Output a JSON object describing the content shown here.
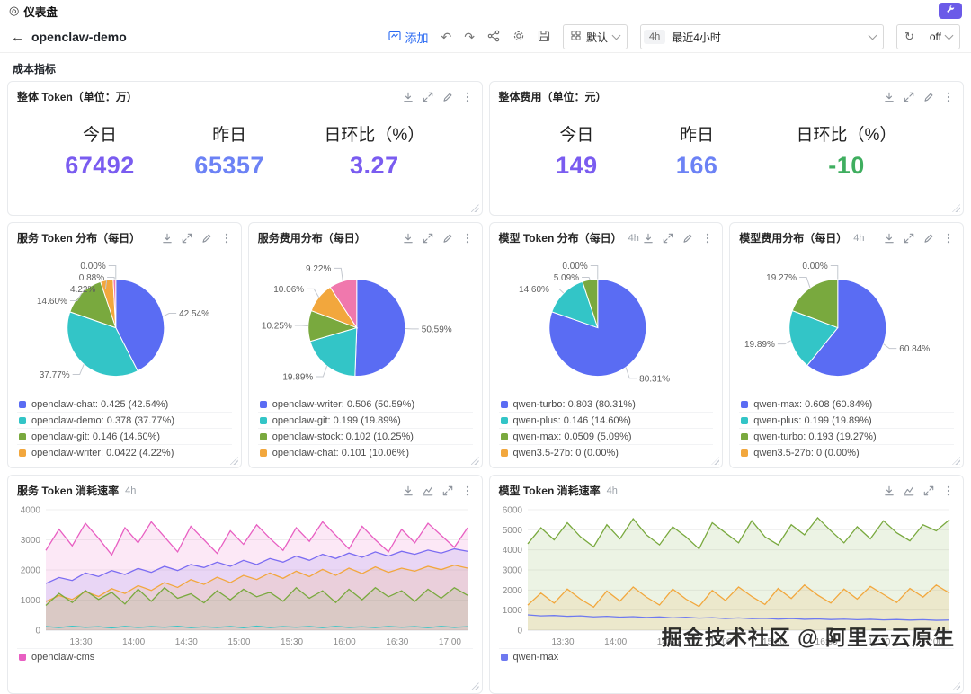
{
  "topbar": {
    "brand": "仪表盘",
    "brand_icon": "◎"
  },
  "navbar": {
    "back_icon": "←",
    "dashboard_name": "openclaw-demo",
    "add_label": "添加",
    "undo_icon": "↶",
    "redo_icon": "↷",
    "view_select": {
      "value": "默认"
    },
    "time_picker": {
      "chip": "4h",
      "value": "最近4小时"
    },
    "refresh": {
      "icon": "↻",
      "interval": "off"
    }
  },
  "section_title": "成本指标",
  "watermark": "掘金技术社区 @ 阿里云云原生",
  "colors": {
    "accent_button": "#6b5ae8",
    "add_link": "#2a6af2",
    "stat_purple": "#7a5cf0",
    "stat_blue": "#6c82f5",
    "stat_green": "#3fae5f",
    "pie_purple": "#5a6cf3",
    "pie_teal": "#33c5c7",
    "pie_green": "#79a93e",
    "pie_orange": "#f2a73d",
    "pie_pink": "#f078ad"
  },
  "stat_panels": [
    {
      "title": "整体 Token（单位：万）",
      "stats": [
        {
          "label": "今日",
          "value": "67492",
          "color": "#7a5cf0"
        },
        {
          "label": "昨日",
          "value": "65357",
          "color": "#6c82f5"
        },
        {
          "label": "日环比（%）",
          "value": "3.27",
          "color": "#7a5cf0"
        }
      ]
    },
    {
      "title": "整体费用（单位：元）",
      "stats": [
        {
          "label": "今日",
          "value": "149",
          "color": "#7a5cf0"
        },
        {
          "label": "昨日",
          "value": "166",
          "color": "#6c82f5"
        },
        {
          "label": "日环比（%）",
          "value": "-10",
          "color": "#3fae5f"
        }
      ]
    }
  ],
  "pie_panels": [
    {
      "title": "服务 Token 分布（每日）",
      "badge": "",
      "chart": {
        "type": "pie",
        "values": [
          42.54,
          37.77,
          14.6,
          4.22,
          0.88,
          0
        ],
        "labels": [
          "42.54%",
          "37.77%",
          "14.60%",
          "4.22%",
          "0.88%",
          "0.00%"
        ],
        "colors": [
          "#5a6cf3",
          "#33c5c7",
          "#79a93e",
          "#f2a73d",
          "#f078ad",
          "#b9aef7"
        ]
      },
      "legend": [
        {
          "name": "openclaw-chat",
          "value": "0.425",
          "pct": "42.54%",
          "color": "#5a6cf3"
        },
        {
          "name": "openclaw-demo",
          "value": "0.378",
          "pct": "37.77%",
          "color": "#33c5c7"
        },
        {
          "name": "openclaw-git",
          "value": "0.146",
          "pct": "14.60%",
          "color": "#79a93e"
        },
        {
          "name": "openclaw-writer",
          "value": "0.0422",
          "pct": "4.22%",
          "color": "#f2a73d"
        }
      ]
    },
    {
      "title": "服务费用分布（每日）",
      "badge": "",
      "chart": {
        "type": "pie",
        "values": [
          50.59,
          19.89,
          10.25,
          10.06,
          9.22
        ],
        "labels": [
          "50.59%",
          "19.89%",
          "10.25%",
          "10.06%",
          "9.22%"
        ],
        "colors": [
          "#5a6cf3",
          "#33c5c7",
          "#79a93e",
          "#f2a73d",
          "#f078ad"
        ]
      },
      "legend": [
        {
          "name": "openclaw-writer",
          "value": "0.506",
          "pct": "50.59%",
          "color": "#5a6cf3"
        },
        {
          "name": "openclaw-git",
          "value": "0.199",
          "pct": "19.89%",
          "color": "#33c5c7"
        },
        {
          "name": "openclaw-stock",
          "value": "0.102",
          "pct": "10.25%",
          "color": "#79a93e"
        },
        {
          "name": "openclaw-chat",
          "value": "0.101",
          "pct": "10.06%",
          "color": "#f2a73d"
        }
      ]
    },
    {
      "title": "模型 Token 分布（每日）",
      "badge": "4h",
      "chart": {
        "type": "pie",
        "values": [
          80.31,
          14.6,
          5.09,
          0
        ],
        "labels": [
          "80.31%",
          "14.60%",
          "5.09%",
          "0.00%"
        ],
        "colors": [
          "#5a6cf3",
          "#33c5c7",
          "#79a93e",
          "#f2a73d"
        ]
      },
      "legend": [
        {
          "name": "qwen-turbo",
          "value": "0.803",
          "pct": "80.31%",
          "color": "#5a6cf3"
        },
        {
          "name": "qwen-plus",
          "value": "0.146",
          "pct": "14.60%",
          "color": "#33c5c7"
        },
        {
          "name": "qwen-max",
          "value": "0.0509",
          "pct": "5.09%",
          "color": "#79a93e"
        },
        {
          "name": "qwen3.5-27b",
          "value": "0",
          "pct": "0.00%",
          "color": "#f2a73d"
        }
      ]
    },
    {
      "title": "模型费用分布（每日）",
      "badge": "4h",
      "chart": {
        "type": "pie",
        "values": [
          60.84,
          19.89,
          19.27,
          0
        ],
        "labels": [
          "60.84%",
          "19.89%",
          "19.27%",
          "0.00%"
        ],
        "colors": [
          "#5a6cf3",
          "#33c5c7",
          "#79a93e",
          "#f2a73d"
        ]
      },
      "legend": [
        {
          "name": "qwen-max",
          "value": "0.608",
          "pct": "60.84%",
          "color": "#5a6cf3"
        },
        {
          "name": "qwen-plus",
          "value": "0.199",
          "pct": "19.89%",
          "color": "#33c5c7"
        },
        {
          "name": "qwen-turbo",
          "value": "0.193",
          "pct": "19.27%",
          "color": "#79a93e"
        },
        {
          "name": "qwen3.5-27b",
          "value": "0",
          "pct": "0.00%",
          "color": "#f2a73d"
        }
      ]
    }
  ],
  "ts_panels": [
    {
      "title": "服务 Token 消耗速率",
      "badge": "4h",
      "chart": {
        "type": "line",
        "yticks": [
          0,
          1000,
          2000,
          3000,
          4000
        ],
        "xlabels": [
          "13:30",
          "14:00",
          "14:30",
          "15:00",
          "15:30",
          "16:00",
          "16:30",
          "17:00"
        ],
        "series": [
          {
            "name": "openclaw-cms",
            "color": "#e85fc2",
            "fill": true,
            "values": [
              2650,
              3350,
              2800,
              3550,
              3050,
              2500,
              3400,
              2900,
              3600,
              3100,
              2600,
              3450,
              3000,
              2550,
              3300,
              2850,
              3500,
              3050,
              2650,
              3400,
              2950,
              3600,
              3150,
              2700,
              3450,
              3000,
              2600,
              3350,
              2900,
              3550,
              3150,
              2750,
              3400
            ]
          },
          {
            "color": "#7b6cf2",
            "fill": true,
            "values": [
              1550,
              1750,
              1650,
              1900,
              1780,
              1980,
              1850,
              2050,
              1920,
              2120,
              1980,
              2180,
              2080,
              2260,
              2120,
              2320,
              2180,
              2380,
              2260,
              2460,
              2320,
              2520,
              2380,
              2560,
              2420,
              2600,
              2460,
              2620,
              2520,
              2660,
              2560,
              2700,
              2620
            ]
          },
          {
            "color": "#f2a73d",
            "fill": true,
            "values": [
              950,
              1150,
              1020,
              1280,
              1120,
              1380,
              1220,
              1480,
              1320,
              1580,
              1420,
              1680,
              1520,
              1760,
              1580,
              1820,
              1680,
              1900,
              1720,
              1960,
              1780,
              2020,
              1820,
              2060,
              1880,
              2100,
              1920,
              2060,
              1960,
              2120,
              2010,
              2160,
              2060
            ]
          },
          {
            "color": "#79a93e",
            "fill": true,
            "values": [
              820,
              1220,
              920,
              1320,
              1020,
              1260,
              870,
              1360,
              960,
              1410,
              1060,
              1210,
              910,
              1310,
              1010,
              1360,
              1110,
              1260,
              960,
              1410,
              1060,
              1310,
              920,
              1360,
              1010,
              1410,
              1110,
              1310,
              960,
              1360,
              1060,
              1410,
              1160
            ]
          },
          {
            "color": "#33c5c7",
            "fill": false,
            "values": [
              120,
              85,
              130,
              95,
              115,
              75,
              125,
              90,
              118,
              98,
              128,
              82,
              112,
              92,
              122,
              78,
              132,
              88,
              118,
              96,
              122,
              82,
              126,
              92,
              112,
              86,
              122,
              96,
              118,
              82,
              126,
              92,
              116
            ]
          }
        ]
      },
      "legend": [
        {
          "name": "openclaw-cms",
          "color": "#e85fc2"
        }
      ]
    },
    {
      "title": "模型 Token 消耗速率",
      "badge": "4h",
      "chart": {
        "type": "line",
        "yticks": [
          0,
          1000,
          2000,
          3000,
          4000,
          5000,
          6000
        ],
        "xlabels": [
          "13:30",
          "14:00",
          "14:30",
          "15:00",
          "15:30",
          "16:00",
          "16:30",
          "17:00"
        ],
        "series": [
          {
            "color": "#79a93e",
            "fill": true,
            "values": [
              4300,
              5100,
              4500,
              5350,
              4650,
              4150,
              5250,
              4550,
              5550,
              4750,
              4250,
              5150,
              4650,
              4050,
              5350,
              4850,
              4350,
              5450,
              4650,
              4250,
              5250,
              4750,
              5600,
              4950,
              4350,
              5150,
              4550,
              5450,
              4850,
              4450,
              5250,
              4950,
              5500
            ]
          },
          {
            "color": "#f2a73d",
            "fill": true,
            "values": [
              1250,
              1850,
              1350,
              2050,
              1550,
              1150,
              1950,
              1450,
              2150,
              1650,
              1250,
              2050,
              1550,
              1180,
              1980,
              1480,
              2150,
              1680,
              1280,
              2080,
              1580,
              2250,
              1750,
              1350,
              2050,
              1550,
              2180,
              1780,
              1380,
              2080,
              1650,
              2250,
              1850
            ]
          },
          {
            "name": "qwen-max",
            "color": "#6e79f0",
            "fill": false,
            "values": [
              760,
              710,
              730,
              690,
              710,
              660,
              690,
              650,
              670,
              630,
              660,
              610,
              640,
              600,
              620,
              580,
              610,
              570,
              590,
              550,
              580,
              540,
              560,
              530,
              550,
              520,
              540,
              510,
              530,
              500,
              520,
              490,
              505
            ]
          }
        ]
      },
      "legend": [
        {
          "name": "qwen-max",
          "color": "#6e79f0"
        }
      ]
    }
  ]
}
